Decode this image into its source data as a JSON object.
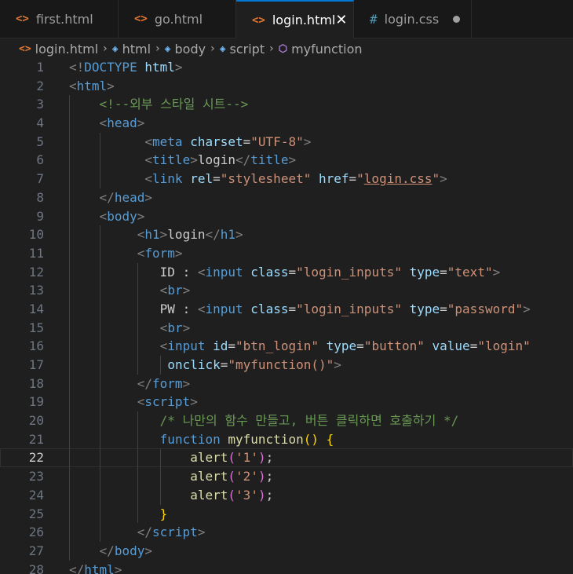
{
  "tabs": [
    {
      "label": "first.html",
      "icon": "html-file-icon"
    },
    {
      "label": "go.html",
      "icon": "html-file-icon"
    },
    {
      "label": "login.html",
      "icon": "html-file-icon",
      "active": true
    },
    {
      "label": "login.css",
      "icon": "css-file-icon",
      "modified": true
    }
  ],
  "breadcrumb": [
    "login.html",
    "html",
    "body",
    "script",
    "myfunction"
  ],
  "editor": {
    "current_line": 22,
    "lines": [
      {
        "n": "1",
        "ind": 0,
        "g": 0,
        "t": [
          [
            "tg",
            "<!"
          ],
          [
            "tn",
            "DOCTYPE"
          ],
          [
            "",
            " "
          ],
          [
            "at",
            "html"
          ],
          [
            "tg",
            ">"
          ]
        ]
      },
      {
        "n": "2",
        "ind": 0,
        "g": 0,
        "t": [
          [
            "tg",
            "<"
          ],
          [
            "tn",
            "html"
          ],
          [
            "tg",
            ">"
          ]
        ]
      },
      {
        "n": "3",
        "ind": 4,
        "g": 1,
        "t": [
          [
            "cm",
            "<!--외부 스타일 시트-->"
          ]
        ]
      },
      {
        "n": "4",
        "ind": 4,
        "g": 1,
        "t": [
          [
            "tg",
            "<"
          ],
          [
            "tn",
            "head"
          ],
          [
            "tg",
            ">"
          ]
        ]
      },
      {
        "n": "5",
        "ind": 10,
        "g": 2,
        "t": [
          [
            "tg",
            "<"
          ],
          [
            "tn",
            "meta"
          ],
          [
            "",
            " "
          ],
          [
            "at",
            "charset"
          ],
          [
            "",
            "="
          ],
          [
            "st",
            "\"UTF-8\""
          ],
          [
            "tg",
            ">"
          ]
        ]
      },
      {
        "n": "6",
        "ind": 10,
        "g": 2,
        "t": [
          [
            "tg",
            "<"
          ],
          [
            "tn",
            "title"
          ],
          [
            "tg",
            ">"
          ],
          [
            "",
            "login"
          ],
          [
            "tg",
            "</"
          ],
          [
            "tn",
            "title"
          ],
          [
            "tg",
            ">"
          ]
        ]
      },
      {
        "n": "7",
        "ind": 10,
        "g": 2,
        "t": [
          [
            "tg",
            "<"
          ],
          [
            "tn",
            "link"
          ],
          [
            "",
            " "
          ],
          [
            "at",
            "rel"
          ],
          [
            "",
            "="
          ],
          [
            "st",
            "\"stylesheet\""
          ],
          [
            "",
            " "
          ],
          [
            "at",
            "href"
          ],
          [
            "",
            "="
          ],
          [
            "st",
            "\""
          ],
          [
            "st ul",
            "login.css"
          ],
          [
            "st",
            "\""
          ],
          [
            "tg",
            ">"
          ]
        ]
      },
      {
        "n": "8",
        "ind": 4,
        "g": 1,
        "t": [
          [
            "tg",
            "</"
          ],
          [
            "tn",
            "head"
          ],
          [
            "tg",
            ">"
          ]
        ]
      },
      {
        "n": "9",
        "ind": 4,
        "g": 1,
        "t": [
          [
            "tg",
            "<"
          ],
          [
            "tn",
            "body"
          ],
          [
            "tg",
            ">"
          ]
        ]
      },
      {
        "n": "10",
        "ind": 9,
        "g": 2,
        "t": [
          [
            "tg",
            "<"
          ],
          [
            "tn",
            "h1"
          ],
          [
            "tg",
            ">"
          ],
          [
            "",
            "login"
          ],
          [
            "tg",
            "</"
          ],
          [
            "tn",
            "h1"
          ],
          [
            "tg",
            ">"
          ]
        ]
      },
      {
        "n": "11",
        "ind": 9,
        "g": 2,
        "t": [
          [
            "tg",
            "<"
          ],
          [
            "tn",
            "form"
          ],
          [
            "tg",
            ">"
          ]
        ]
      },
      {
        "n": "12",
        "ind": 12,
        "g": 3,
        "t": [
          [
            "",
            "ID : "
          ],
          [
            "tg",
            "<"
          ],
          [
            "tn",
            "input"
          ],
          [
            "",
            " "
          ],
          [
            "at",
            "class"
          ],
          [
            "",
            "="
          ],
          [
            "st",
            "\"login_inputs\""
          ],
          [
            "",
            " "
          ],
          [
            "at",
            "type"
          ],
          [
            "",
            "="
          ],
          [
            "st",
            "\"text\""
          ],
          [
            "tg",
            ">"
          ]
        ]
      },
      {
        "n": "13",
        "ind": 12,
        "g": 3,
        "t": [
          [
            "tg",
            "<"
          ],
          [
            "tn",
            "br"
          ],
          [
            "tg",
            ">"
          ]
        ]
      },
      {
        "n": "14",
        "ind": 12,
        "g": 3,
        "t": [
          [
            "",
            "PW : "
          ],
          [
            "tg",
            "<"
          ],
          [
            "tn",
            "input"
          ],
          [
            "",
            " "
          ],
          [
            "at",
            "class"
          ],
          [
            "",
            "="
          ],
          [
            "st",
            "\"login_inputs\""
          ],
          [
            "",
            " "
          ],
          [
            "at",
            "type"
          ],
          [
            "",
            "="
          ],
          [
            "st",
            "\"password\""
          ],
          [
            "tg",
            ">"
          ]
        ]
      },
      {
        "n": "15",
        "ind": 12,
        "g": 3,
        "t": [
          [
            "tg",
            "<"
          ],
          [
            "tn",
            "br"
          ],
          [
            "tg",
            ">"
          ]
        ]
      },
      {
        "n": "16",
        "ind": 12,
        "g": 3,
        "t": [
          [
            "tg",
            "<"
          ],
          [
            "tn",
            "input"
          ],
          [
            "",
            " "
          ],
          [
            "at",
            "id"
          ],
          [
            "",
            "="
          ],
          [
            "st",
            "\"btn_login\""
          ],
          [
            "",
            " "
          ],
          [
            "at",
            "type"
          ],
          [
            "",
            "="
          ],
          [
            "st",
            "\"button\""
          ],
          [
            "",
            " "
          ],
          [
            "at",
            "value"
          ],
          [
            "",
            "="
          ],
          [
            "st",
            "\"login\""
          ]
        ]
      },
      {
        "n": "17",
        "ind": 13,
        "g": 4,
        "t": [
          [
            "at",
            "onclick"
          ],
          [
            "",
            "="
          ],
          [
            "st",
            "\"myfunction()\""
          ],
          [
            "tg",
            ">"
          ]
        ]
      },
      {
        "n": "18",
        "ind": 9,
        "g": 2,
        "t": [
          [
            "tg",
            "</"
          ],
          [
            "tn",
            "form"
          ],
          [
            "tg",
            ">"
          ]
        ]
      },
      {
        "n": "19",
        "ind": 9,
        "g": 2,
        "t": [
          [
            "tg",
            "<"
          ],
          [
            "tn",
            "script"
          ],
          [
            "tg",
            ">"
          ]
        ]
      },
      {
        "n": "20",
        "ind": 12,
        "g": 3,
        "t": [
          [
            "cm",
            "/* 나만의 함수 만들고, 버튼 클릭하면 호출하기 */"
          ]
        ]
      },
      {
        "n": "21",
        "ind": 12,
        "g": 3,
        "t": [
          [
            "kw",
            "function"
          ],
          [
            "",
            " "
          ],
          [
            "fnn",
            "myfunction"
          ],
          [
            "br",
            "()"
          ],
          [
            "",
            " "
          ],
          [
            "br",
            "{"
          ]
        ]
      },
      {
        "n": "22",
        "ind": 16,
        "g": 4,
        "t": [
          [
            "fnn",
            "alert"
          ],
          [
            "br2",
            "("
          ],
          [
            "st",
            "'1'"
          ],
          [
            "br2",
            ")"
          ],
          [
            "",
            ";"
          ]
        ]
      },
      {
        "n": "23",
        "ind": 16,
        "g": 4,
        "t": [
          [
            "fnn",
            "alert"
          ],
          [
            "br2",
            "("
          ],
          [
            "st",
            "'2'"
          ],
          [
            "br2",
            ")"
          ],
          [
            "",
            ";"
          ]
        ]
      },
      {
        "n": "24",
        "ind": 16,
        "g": 4,
        "t": [
          [
            "fnn",
            "alert"
          ],
          [
            "br2",
            "("
          ],
          [
            "st",
            "'3'"
          ],
          [
            "br2",
            ")"
          ],
          [
            "",
            ";"
          ]
        ]
      },
      {
        "n": "25",
        "ind": 12,
        "g": 3,
        "t": [
          [
            "br",
            "}"
          ]
        ]
      },
      {
        "n": "26",
        "ind": 9,
        "g": 2,
        "t": [
          [
            "tg",
            "</"
          ],
          [
            "tn",
            "script"
          ],
          [
            "tg",
            ">"
          ]
        ]
      },
      {
        "n": "27",
        "ind": 4,
        "g": 1,
        "t": [
          [
            "tg",
            "</"
          ],
          [
            "tn",
            "body"
          ],
          [
            "tg",
            ">"
          ]
        ]
      },
      {
        "n": "28",
        "ind": 0,
        "g": 0,
        "t": [
          [
            "tg",
            "</"
          ],
          [
            "tn",
            "html"
          ],
          [
            "tg",
            ">"
          ]
        ]
      }
    ]
  }
}
